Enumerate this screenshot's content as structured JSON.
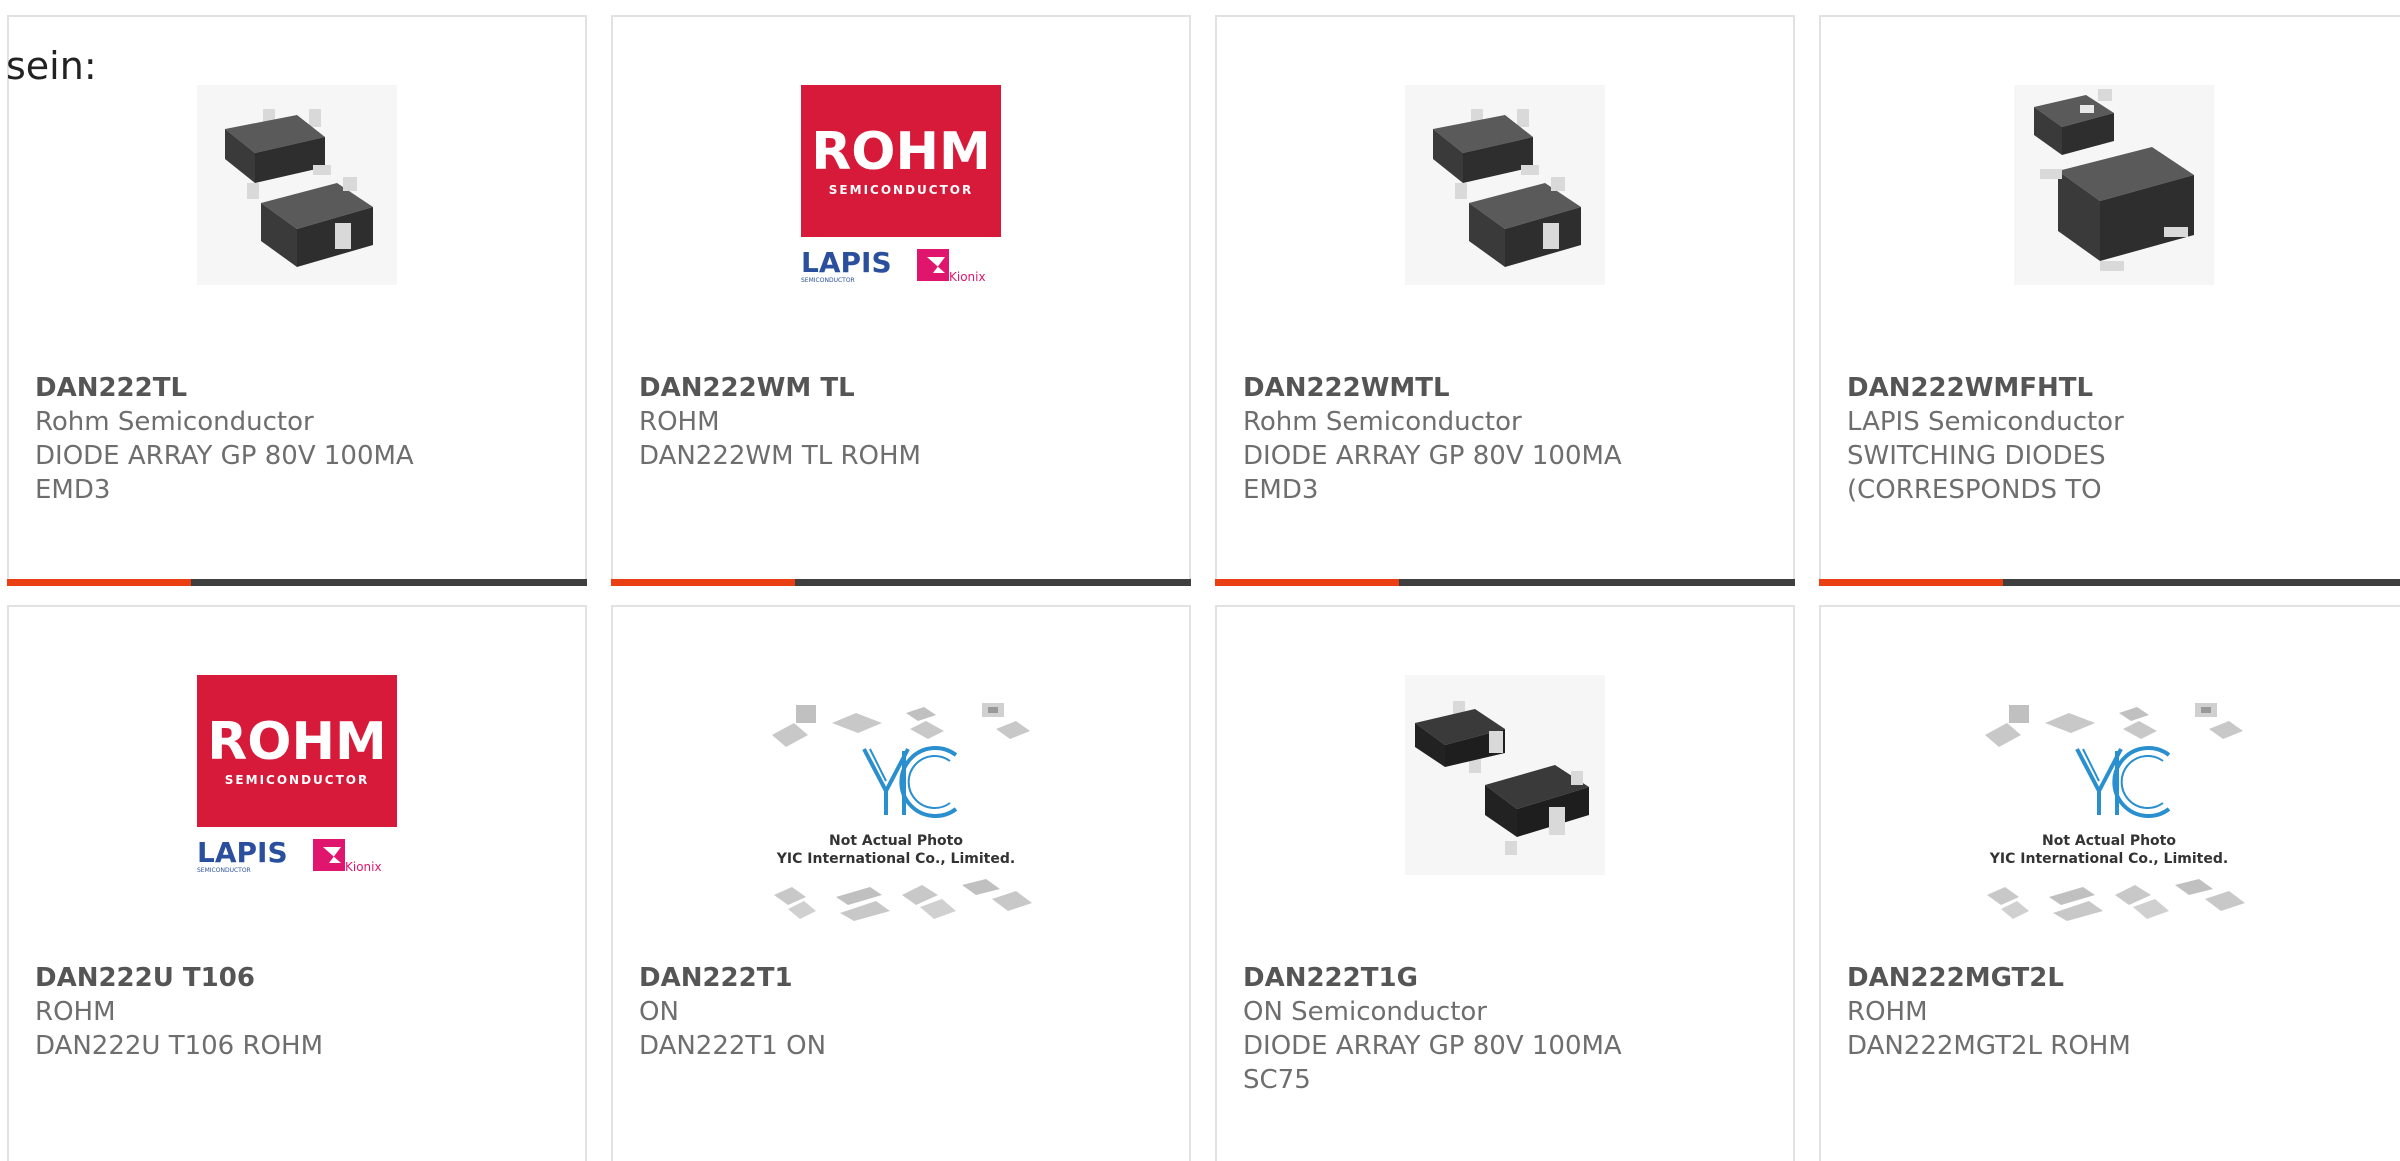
{
  "intro_text": "sein:",
  "colors": {
    "accent": "#ea3f13",
    "bar_dark": "#3f3f3f",
    "text": "#6e6e6e"
  },
  "products": [
    {
      "part": "DAN222TL",
      "manufacturer": "Rohm Semiconductor",
      "line1": "DIODE ARRAY GP 80V 100MA",
      "line2": "EMD3",
      "image": "sot-package-photo-icon"
    },
    {
      "part": "DAN222WM TL",
      "manufacturer": "ROHM",
      "line1": "DAN222WM TL ROHM",
      "line2": "",
      "image": "rohm-logo",
      "logo": {
        "brand": "ROHM",
        "sub": "SEMICONDUCTOR",
        "lapis": "LAPIS",
        "lapis_sub": "SEMICONDUCTOR",
        "kionix": "Kionix"
      }
    },
    {
      "part": "DAN222WMTL",
      "manufacturer": "Rohm Semiconductor",
      "line1": "DIODE ARRAY GP 80V 100MA",
      "line2": "EMD3",
      "image": "sot-package-photo-icon"
    },
    {
      "part": "DAN222WMFHTL",
      "manufacturer": "LAPIS Semiconductor",
      "line1": "SWITCHING DIODES",
      "line2": "(CORRESPONDS TO",
      "image": "sod-package-photo-icon"
    },
    {
      "part": "DAN222U T106",
      "manufacturer": "ROHM",
      "line1": "DAN222U T106 ROHM",
      "line2": "",
      "image": "rohm-logo",
      "logo": {
        "brand": "ROHM",
        "sub": "SEMICONDUCTOR",
        "lapis": "LAPIS",
        "lapis_sub": "SEMICONDUCTOR",
        "kionix": "Kionix"
      }
    },
    {
      "part": "DAN222T1",
      "manufacturer": "ON",
      "line1": "DAN222T1 ON",
      "line2": "",
      "image": "yic-placeholder",
      "placeholder": {
        "brand": "YIC",
        "caption1": "Not Actual Photo",
        "caption2": "YIC International Co., Limited."
      }
    },
    {
      "part": "DAN222T1G",
      "manufacturer": "ON Semiconductor",
      "line1": "DIODE ARRAY GP 80V 100MA",
      "line2": "SC75",
      "image": "sot-package-photo-icon"
    },
    {
      "part": "DAN222MGT2L",
      "manufacturer": "ROHM",
      "line1": "DAN222MGT2L ROHM",
      "line2": "",
      "image": "yic-placeholder",
      "placeholder": {
        "brand": "YIC",
        "caption1": "Not Actual Photo",
        "caption2": "YIC International Co., Limited."
      }
    }
  ]
}
